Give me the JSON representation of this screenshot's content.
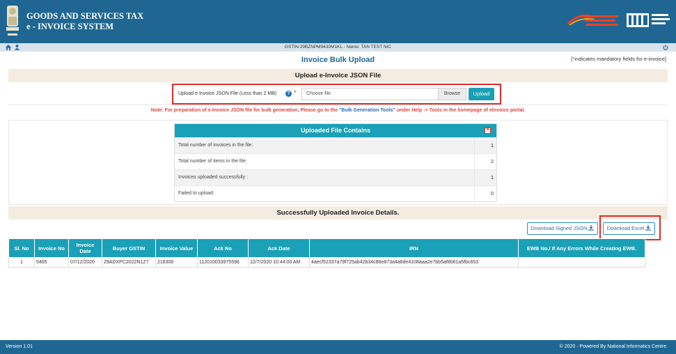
{
  "header": {
    "title_line1": "GOODS AND SERVICES TAX",
    "title_line2": "e - INVOICE SYSTEM"
  },
  "subbar": {
    "gstin_text": "GSTIN:29BZNPM9430M1KL - Name: TAN TEST NIC"
  },
  "page": {
    "title": "Invoice Bulk Upload",
    "mandatory_star": "*",
    "mandatory_text": "indicates mandatory fields for e-invoice]",
    "mandatory_open": "["
  },
  "upload_section": {
    "heading": "Upload e-Invoice JSON File",
    "label": "Upload e Invoice JSON File (Less than 2 MB)",
    "help": "?",
    "required_star": "*",
    "file_placeholder": "Choose file",
    "browse_label": "Browse",
    "upload_label": "Upload"
  },
  "note": {
    "prefix": "Note: For preparation of e-Invoice JSON file for bulk generation, Please go to the ",
    "link": "\"Bulk Generation Tools\"",
    "suffix": " under Help -> Tools in the homepage of eInvoice portal."
  },
  "result": {
    "heading": "Uploaded File Contains",
    "close": "×",
    "rows": [
      {
        "label": "Total number of invoices in the file:",
        "value": "1"
      },
      {
        "label": "Total number of items in the file:",
        "value": "2"
      },
      {
        "label": "Invoices uploaded successfully :",
        "value": "1"
      },
      {
        "label": "Failed to upload:",
        "value": "0"
      }
    ]
  },
  "details": {
    "heading": "Successfully Uploaded Invoice Details.",
    "download_signed_label": "Download Signed JSON",
    "download_excel_label": "Download Excel",
    "columns": [
      "Sl. No",
      "Invoice No",
      "Invoice Date",
      "Buyer GSTIN",
      "Invoice Value",
      "Ack No",
      "Ack Date",
      "IRN",
      "EWB No./ If Any Errors While Creating EWB."
    ],
    "rows": [
      [
        "1",
        "5465",
        "07/12/2020",
        "29ADXPC2022N1Z7",
        "218300",
        "112010033975596",
        "12/7/2020 10:44:00 AM",
        "4aecf52337a79f725ab42b34c86e873a4a8de4108aaa2e7bb5af8b61a5fbc653",
        ""
      ]
    ]
  },
  "footer": {
    "version": "Version 1.01",
    "copyright": "© 2020 · Powered By National Informatics Centre."
  },
  "colors": {
    "header_bg": "#1f6792",
    "accent_teal": "#1aa0b7",
    "highlight_red": "#e02a2a"
  },
  "icons": [
    "home-icon",
    "user-icon",
    "power-icon",
    "help-icon",
    "download-icon",
    "close-icon"
  ]
}
